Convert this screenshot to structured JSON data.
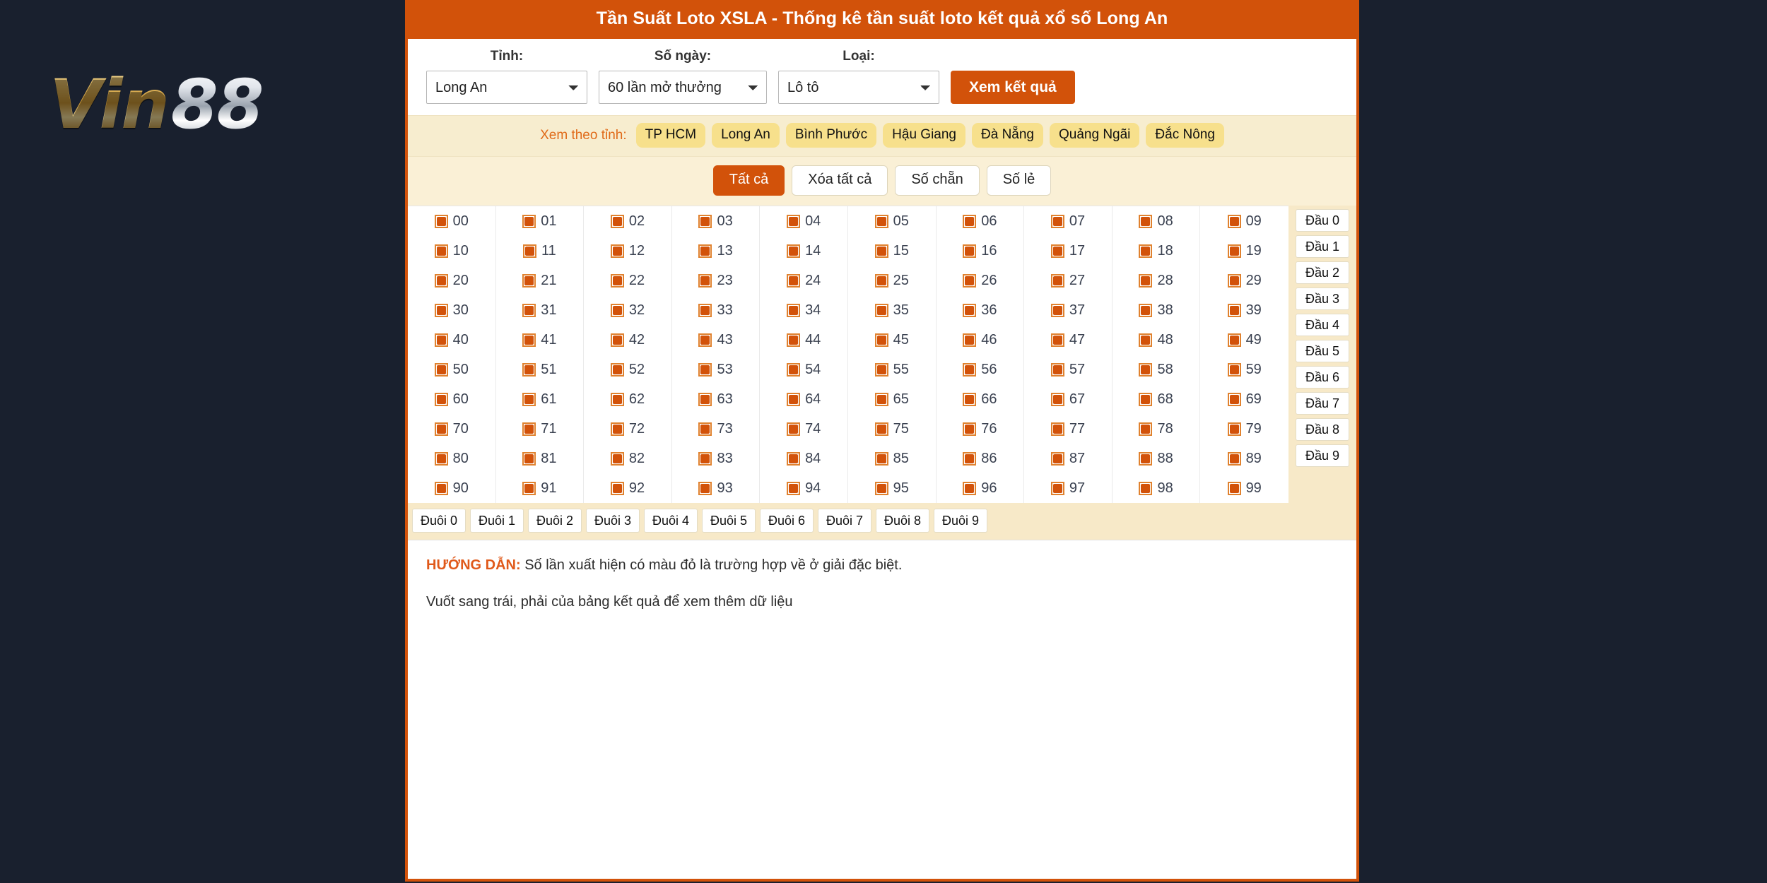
{
  "brand": {
    "part1": "Vin",
    "part2": "88"
  },
  "card": {
    "title": "Tần Suất Loto XSLA - Thống kê tần suất loto kết quả xổ số Long An"
  },
  "filters": {
    "province": {
      "label": "Tỉnh:",
      "value": "Long An",
      "options": [
        "Long An"
      ]
    },
    "days": {
      "label": "Số ngày:",
      "value": "60 lần mở thưởng",
      "options": [
        "60 lần mở thưởng"
      ]
    },
    "type": {
      "label": "Loại:",
      "value": "Lô tô",
      "options": [
        "Lô tô"
      ]
    },
    "submit_label": "Xem kết quả"
  },
  "province_tags": {
    "label": "Xem theo tỉnh:",
    "items": [
      "TP HCM",
      "Long An",
      "Bình Phước",
      "Hậu Giang",
      "Đà Nẵng",
      "Quảng Ngãi",
      "Đắc Nông"
    ]
  },
  "toggles": {
    "items": [
      {
        "label": "Tất cả",
        "active": true
      },
      {
        "label": "Xóa tất cả",
        "active": false
      },
      {
        "label": "Số chẵn",
        "active": false
      },
      {
        "label": "Số lẻ",
        "active": false
      }
    ]
  },
  "grid": {
    "numbers": [
      "00",
      "01",
      "02",
      "03",
      "04",
      "05",
      "06",
      "07",
      "08",
      "09",
      "10",
      "11",
      "12",
      "13",
      "14",
      "15",
      "16",
      "17",
      "18",
      "19",
      "20",
      "21",
      "22",
      "23",
      "24",
      "25",
      "26",
      "27",
      "28",
      "29",
      "30",
      "31",
      "32",
      "33",
      "34",
      "35",
      "36",
      "37",
      "38",
      "39",
      "40",
      "41",
      "42",
      "43",
      "44",
      "45",
      "46",
      "47",
      "48",
      "49",
      "50",
      "51",
      "52",
      "53",
      "54",
      "55",
      "56",
      "57",
      "58",
      "59",
      "60",
      "61",
      "62",
      "63",
      "64",
      "65",
      "66",
      "67",
      "68",
      "69",
      "70",
      "71",
      "72",
      "73",
      "74",
      "75",
      "76",
      "77",
      "78",
      "79",
      "80",
      "81",
      "82",
      "83",
      "84",
      "85",
      "86",
      "87",
      "88",
      "89",
      "90",
      "91",
      "92",
      "93",
      "94",
      "95",
      "96",
      "97",
      "98",
      "99"
    ],
    "all_checked": true,
    "head_buttons": [
      "Đầu 0",
      "Đầu 1",
      "Đầu 2",
      "Đầu 3",
      "Đầu 4",
      "Đầu 5",
      "Đầu 6",
      "Đầu 7",
      "Đầu 8",
      "Đầu 9"
    ],
    "tail_buttons": [
      "Đuôi 0",
      "Đuôi 1",
      "Đuôi 2",
      "Đuôi 3",
      "Đuôi 4",
      "Đuôi 5",
      "Đuôi 6",
      "Đuôi 7",
      "Đuôi 8",
      "Đuôi 9"
    ]
  },
  "guide": {
    "heading": "HƯỚNG DẪN:",
    "line1": "Số lần xuất hiện có màu đỏ là trường hợp về ở giải đặc biệt.",
    "line2": "Vuốt sang trái, phải của bảng kết quả để xem thêm dữ liệu"
  },
  "colors": {
    "page_background": "#19202e",
    "accent_orange": "#d2520a",
    "tag_yellow": "#f7e08c",
    "band_cream": "#faf0d6",
    "head_cream": "#f7e9c8",
    "guide_orange": "#e0591a"
  }
}
